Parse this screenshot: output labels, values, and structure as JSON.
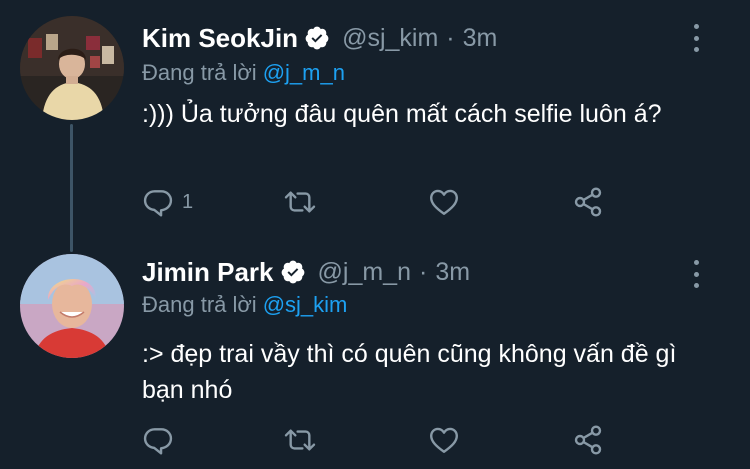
{
  "colors": {
    "background": "#15202b",
    "text_primary": "#ffffff",
    "text_secondary": "#8899a6",
    "link": "#1da1f2",
    "thread_line": "#3d5466"
  },
  "tweets": [
    {
      "display_name": "Kim SeokJin",
      "verified_icon": "verified-badge-icon",
      "handle": "@sj_kim",
      "separator": "·",
      "time": "3m",
      "replying_label": "Đang trả lời",
      "replying_to": "@j_m_n",
      "text": ":))) Ủa tưởng đâu quên mất cách selfie luôn á?",
      "reply_count": "1",
      "actions": [
        "reply-icon",
        "retweet-icon",
        "like-icon",
        "share-icon"
      ]
    },
    {
      "display_name": "Jimin Park",
      "verified_icon": "verified-badge-icon",
      "handle": "@j_m_n",
      "separator": "·",
      "time": "3m",
      "replying_label": "Đang trả lời",
      "replying_to": "@sj_kim",
      "text": ":> đẹp trai vầy thì có quên cũng không vấn đề gì bạn nhó",
      "reply_count": "",
      "actions": [
        "reply-icon",
        "retweet-icon",
        "like-icon",
        "share-icon"
      ]
    }
  ]
}
